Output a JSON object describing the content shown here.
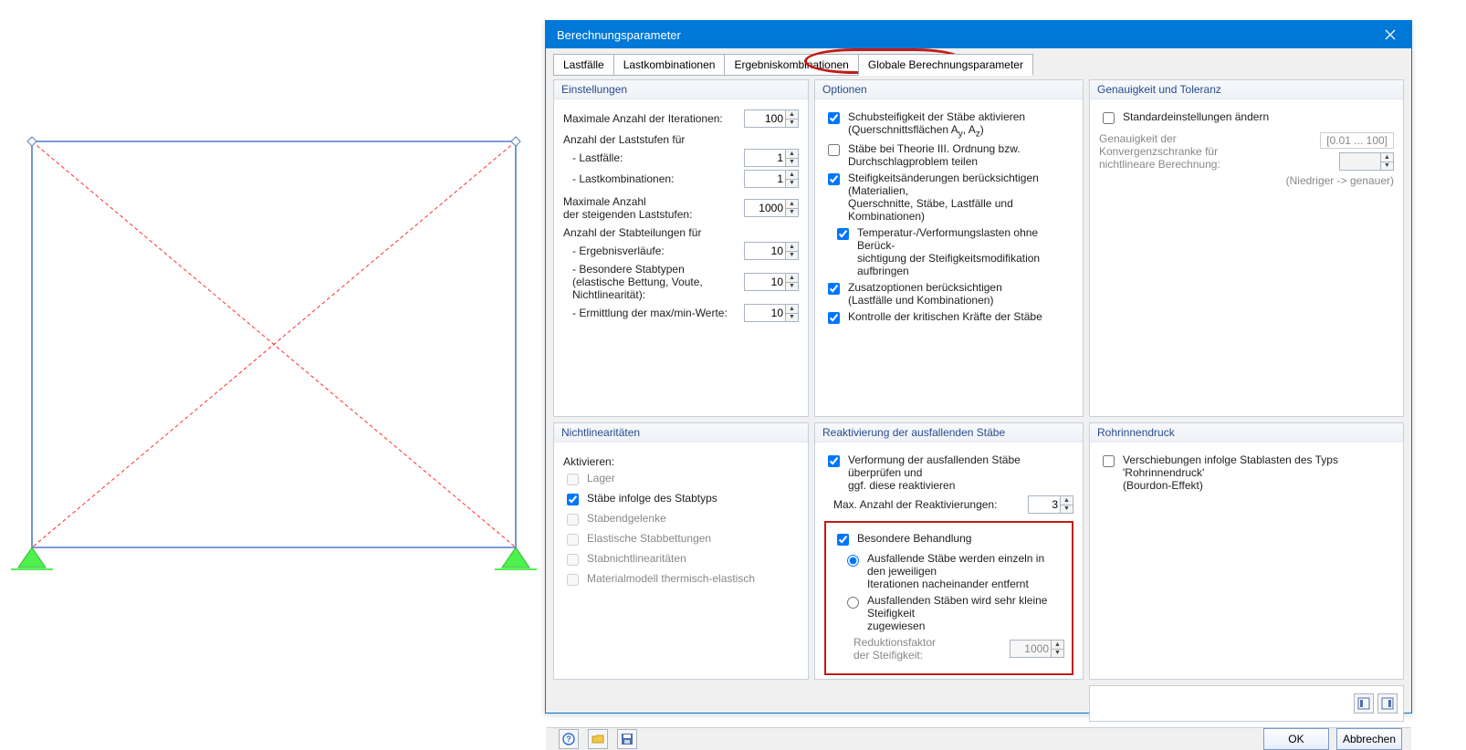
{
  "dialog": {
    "title": "Berechnungsparameter"
  },
  "tabs": [
    {
      "label": "Lastfälle"
    },
    {
      "label": "Lastkombinationen"
    },
    {
      "label": "Ergebniskombinationen"
    },
    {
      "label": "Globale Berechnungsparameter"
    }
  ],
  "settings": {
    "header": "Einstellungen",
    "max_iter_label": "Maximale Anzahl der Iterationen:",
    "max_iter": "100",
    "loadsteps_label": "Anzahl der Laststufen für",
    "lf_label": "- Lastfälle:",
    "lf": "1",
    "lk_label": "- Lastkombinationen:",
    "lk": "1",
    "max_inc_label1": "Maximale Anzahl",
    "max_inc_label2": "der steigenden Laststufen:",
    "max_inc": "1000",
    "divisions_label": "Anzahl der Stabteilungen für",
    "res_label": "- Ergebnisverläufe:",
    "res": "10",
    "spec_label1": "- Besondere Stabtypen",
    "spec_label2": "(elastische Bettung, Voute,",
    "spec_label3": "Nichtlinearität):",
    "spec": "10",
    "maxmin_label": "- Ermittlung der max/min-Werte:",
    "maxmin": "10"
  },
  "options": {
    "header": "Optionen",
    "shear1": "Schubsteifigkeit der Stäbe aktivieren",
    "shear2": "(Querschnittsflächen A",
    "shear_y": "y",
    "shear_sep": ", A",
    "shear_z": "z",
    "shear_end": ")",
    "theory1": "Stäbe bei Theorie III. Ordnung bzw.",
    "theory2": "Durchschlagproblem teilen",
    "stiff1": "Steifigkeitsänderungen berücksichtigen (Materialien,",
    "stiff2": "Querschnitte, Stäbe, Lastfälle und Kombinationen)",
    "temp1": "Temperatur-/Verformungslasten ohne Berück-",
    "temp2": "sichtigung der Steifigkeitsmodifikation aufbringen",
    "extra1": "Zusatzoptionen berücksichtigen",
    "extra2": "(Lastfälle und Kombinationen)",
    "crit": "Kontrolle der kritischen Kräfte der Stäbe"
  },
  "accuracy": {
    "header": "Genauigkeit und Toleranz",
    "chg": "Standardeinstellungen ändern",
    "conv1": "Genauigkeit der",
    "conv2": "Konvergenzschranke für",
    "conv3": "nichtlineare Berechnung:",
    "range": "[0.01 ... 100]",
    "hint": "(Niedriger -> genauer)"
  },
  "nonlin": {
    "header": "Nichtlinearitäten",
    "activate": "Aktivieren:",
    "lager": "Lager",
    "stabtyp": "Stäbe infolge des Stabtyps",
    "gelenk": "Stabendgelenke",
    "bett": "Elastische Stabbettungen",
    "nl": "Stabnichtlinearitäten",
    "mat": "Materialmodell thermisch-elastisch"
  },
  "react": {
    "header": "Reaktivierung der ausfallenden Stäbe",
    "check1": "Verformung der ausfallenden Stäbe überprüfen und",
    "check2": "ggf. diese reaktivieren",
    "maxreact_label": "Max. Anzahl der Reaktivierungen:",
    "maxreact": "3",
    "special": "Besondere Behandlung",
    "r1a": "Ausfallende Stäbe werden einzeln in den jeweiligen",
    "r1b": "Iterationen nacheinander entfernt",
    "r2a": "Ausfallenden Stäben wird sehr kleine Steifigkeit",
    "r2b": "zugewiesen",
    "red1": "Reduktionsfaktor",
    "red2": "der Steifigkeit:",
    "red_val": "1000"
  },
  "pipe": {
    "header": "Rohrinnendruck",
    "lbl1": "Verschiebungen infolge Stablasten des Typs 'Rohrinnendruck'",
    "lbl2": "(Bourdon-Effekt)"
  },
  "footer": {
    "ok": "OK",
    "cancel": "Abbrechen"
  }
}
